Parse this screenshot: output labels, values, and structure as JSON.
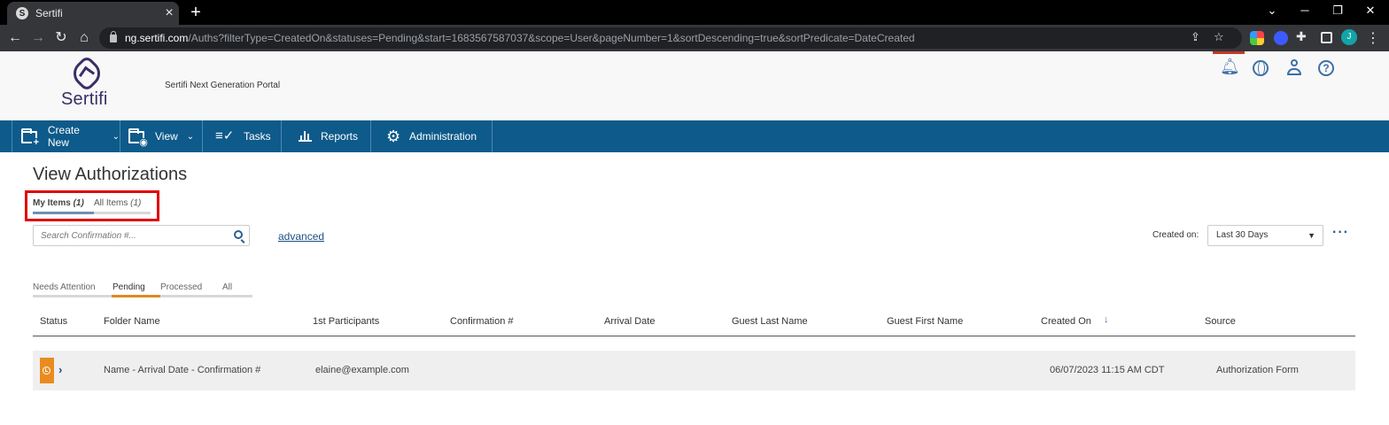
{
  "browser": {
    "tab_title": "Sertifi",
    "tab_favicon_glyph": "S",
    "url_host": "ng.sertifi.com",
    "url_path": "/Auths?filterType=CreatedOn&statuses=Pending&start=1683567587037&scope=User&pageNumber=1&sortDescending=true&sortPredicate=DateCreated",
    "profile_initial": "J"
  },
  "header": {
    "logo_text": "Sertifi",
    "portal_name": "Sertifi Next Generation Portal"
  },
  "nav": {
    "create_new": "Create New",
    "view": "View",
    "tasks": "Tasks",
    "reports": "Reports",
    "administration": "Administration"
  },
  "page": {
    "title": "View Authorizations",
    "scope_tabs": {
      "my_label": "My Items",
      "my_count": "(1)",
      "all_label": "All Items",
      "all_count": "(1)",
      "selected": "my"
    },
    "search_placeholder": "Search Confirmation #...",
    "advanced_link": "advanced",
    "created_on_label": "Created on:",
    "created_on_value": "Last 30 Days",
    "status_tabs": [
      "Needs Attention",
      "Pending",
      "Processed",
      "All"
    ],
    "status_selected": "Pending"
  },
  "table": {
    "columns": [
      "Status",
      "Folder Name",
      "1st Participants",
      "Confirmation #",
      "Arrival Date",
      "Guest Last Name",
      "Guest First Name",
      "Created On",
      "Source"
    ],
    "sort_column": "Created On",
    "sort_direction": "descending",
    "rows": [
      {
        "status": "pending",
        "folder_name": "Name - Arrival Date - Confirmation #",
        "participants": "elaine@example.com",
        "confirmation": "",
        "arrival_date": "",
        "guest_last": "",
        "guest_first": "",
        "created_on": "06/07/2023 11:15 AM CDT",
        "source": "Authorization Form"
      }
    ]
  },
  "colors": {
    "nav_bg": "#0e5a8a",
    "accent_blue": "#3f6ea8",
    "pending_orange": "#e98c1f",
    "highlight_red": "#e00000",
    "brand_purple": "#3b2e64"
  }
}
